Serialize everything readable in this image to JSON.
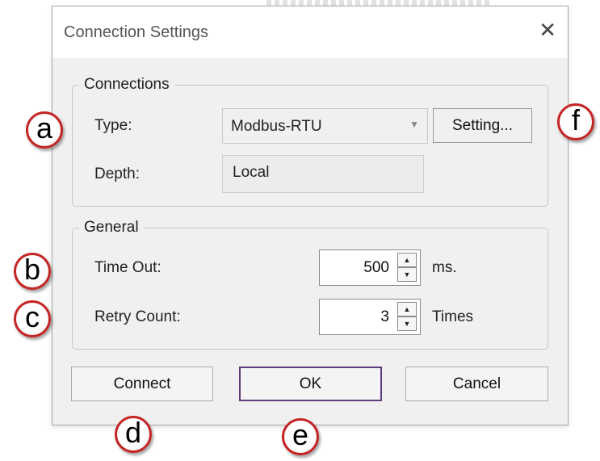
{
  "dialog": {
    "title": "Connection Settings",
    "close_glyph": "✕"
  },
  "connections": {
    "legend": "Connections",
    "type_label": "Type:",
    "type_value": "Modbus-RTU",
    "setting_button": "Setting...",
    "depth_label": "Depth:",
    "depth_value": "Local"
  },
  "general": {
    "legend": "General",
    "timeout_label": "Time Out:",
    "timeout_value": "500",
    "timeout_unit": "ms.",
    "retry_label": "Retry Count:",
    "retry_value": "3",
    "retry_unit": "Times"
  },
  "buttons": {
    "connect": "Connect",
    "ok": "OK",
    "cancel": "Cancel"
  },
  "callouts": {
    "a": "a",
    "b": "b",
    "c": "c",
    "d": "d",
    "e": "e",
    "f": "f"
  },
  "icons": {
    "spin_up": "▲",
    "spin_down": "▼",
    "dropdown": "▼"
  },
  "colors": {
    "callout_border": "#c42525",
    "ok_border": "#5a3d7a",
    "dialog_bg": "#f0f0f0"
  }
}
